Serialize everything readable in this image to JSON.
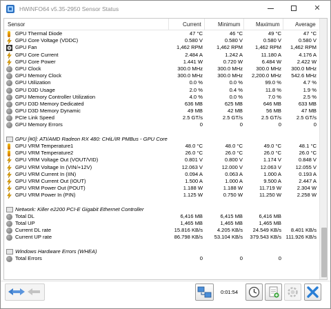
{
  "window": {
    "title": "HWiNFO64 v5.35-2950 Sensor Status"
  },
  "columns": {
    "sensor": "Sensor",
    "current": "Current",
    "minimum": "Minimum",
    "maximum": "Maximum",
    "average": "Average"
  },
  "rows": [
    {
      "kind": "sensor",
      "icon": "thermometer-icon",
      "name": "GPU Thermal Diode",
      "current": "47 °C",
      "minimum": "46 °C",
      "maximum": "49 °C",
      "average": "47 °C"
    },
    {
      "kind": "sensor",
      "icon": "voltage-icon",
      "name": "GPU Core Voltage (VDDC)",
      "current": "0.580 V",
      "minimum": "0.580 V",
      "maximum": "0.580 V",
      "average": "0.580 V"
    },
    {
      "kind": "sensor",
      "icon": "fan-icon",
      "name": "GPU Fan",
      "current": "1,462 RPM",
      "minimum": "1,462 RPM",
      "maximum": "1,462 RPM",
      "average": "1,462 RPM"
    },
    {
      "kind": "sensor",
      "icon": "current-icon",
      "name": "GPU Core Current",
      "current": "2.484 A",
      "minimum": "1.242 A",
      "maximum": "11.180 A",
      "average": "4.176 A"
    },
    {
      "kind": "sensor",
      "icon": "power-icon",
      "name": "GPU Core Power",
      "current": "1.441 W",
      "minimum": "0.720 W",
      "maximum": "6.484 W",
      "average": "2.422 W"
    },
    {
      "kind": "sensor",
      "icon": "clock-icon",
      "name": "GPU Clock",
      "current": "300.0 MHz",
      "minimum": "300.0 MHz",
      "maximum": "300.0 MHz",
      "average": "300.0 MHz"
    },
    {
      "kind": "sensor",
      "icon": "clock-icon",
      "name": "GPU Memory Clock",
      "current": "300.0 MHz",
      "minimum": "300.0 MHz",
      "maximum": "2,200.0 MHz",
      "average": "542.6 MHz"
    },
    {
      "kind": "sensor",
      "icon": "usage-icon",
      "name": "GPU Utilization",
      "current": "0.0 %",
      "minimum": "0.0 %",
      "maximum": "99.0 %",
      "average": "4.7 %"
    },
    {
      "kind": "sensor",
      "icon": "usage-icon",
      "name": "GPU D3D Usage",
      "current": "2.0 %",
      "minimum": "0.4 %",
      "maximum": "11.8 %",
      "average": "1.9 %"
    },
    {
      "kind": "sensor",
      "icon": "usage-icon",
      "name": "GPU Memory Controller Utilization",
      "current": "4.0 %",
      "minimum": "0.0 %",
      "maximum": "7.0 %",
      "average": "2.5 %"
    },
    {
      "kind": "sensor",
      "icon": "memory-icon",
      "name": "GPU D3D Memory Dedicated",
      "current": "636 MB",
      "minimum": "625 MB",
      "maximum": "646 MB",
      "average": "633 MB"
    },
    {
      "kind": "sensor",
      "icon": "memory-icon",
      "name": "GPU D3D Memory Dynamic",
      "current": "49 MB",
      "minimum": "42 MB",
      "maximum": "56 MB",
      "average": "47 MB"
    },
    {
      "kind": "sensor",
      "icon": "link-icon",
      "name": "PCIe Link Speed",
      "current": "2.5 GT/s",
      "minimum": "2.5 GT/s",
      "maximum": "2.5 GT/s",
      "average": "2.5 GT/s"
    },
    {
      "kind": "sensor",
      "icon": "error-icon",
      "name": "GPU Memory Errors",
      "current": "0",
      "minimum": "0",
      "maximum": "0",
      "average": "0"
    },
    {
      "kind": "gap"
    },
    {
      "kind": "group",
      "icon": "gpu-group-icon",
      "name": "GPU [#0]: ATI/AMD Radeon RX 480: CHiL/IR PMBus - GPU Core"
    },
    {
      "kind": "sensor",
      "icon": "thermometer-icon",
      "name": "GPU VRM Temperature1",
      "current": "48.0 °C",
      "minimum": "48.0 °C",
      "maximum": "49.0 °C",
      "average": "48.1 °C"
    },
    {
      "kind": "sensor",
      "icon": "thermometer-icon",
      "name": "GPU VRM Temperature2",
      "current": "26.0 °C",
      "minimum": "26.0 °C",
      "maximum": "26.0 °C",
      "average": "26.0 °C"
    },
    {
      "kind": "sensor",
      "icon": "voltage-icon",
      "name": "GPU VRM Voltage Out (VOUT/VID)",
      "current": "0.801 V",
      "minimum": "0.800 V",
      "maximum": "1.174 V",
      "average": "0.848 V"
    },
    {
      "kind": "sensor",
      "icon": "voltage-icon",
      "name": "GPU VRM Voltage In (VIN/+12V)",
      "current": "12.063 V",
      "minimum": "12.000 V",
      "maximum": "12.063 V",
      "average": "12.055 V"
    },
    {
      "kind": "sensor",
      "icon": "current-icon",
      "name": "GPU VRM Current In (IIN)",
      "current": "0.094 A",
      "minimum": "0.063 A",
      "maximum": "1.000 A",
      "average": "0.193 A"
    },
    {
      "kind": "sensor",
      "icon": "current-icon",
      "name": "GPU VRM Current Out (IOUT)",
      "current": "1.500 A",
      "minimum": "1.000 A",
      "maximum": "9.500 A",
      "average": "2.447 A"
    },
    {
      "kind": "sensor",
      "icon": "power-icon",
      "name": "GPU VRM Power Out (POUT)",
      "current": "1.188 W",
      "minimum": "1.188 W",
      "maximum": "11.719 W",
      "average": "2.304 W"
    },
    {
      "kind": "sensor",
      "icon": "power-icon",
      "name": "GPU VRM Power In (PIN)",
      "current": "1.125 W",
      "minimum": "0.750 W",
      "maximum": "11.250 W",
      "average": "2.258 W"
    },
    {
      "kind": "gap"
    },
    {
      "kind": "group",
      "icon": "network-group-icon",
      "name": "Network: Killer e2200 PCI-E Gigabit Ethernet Controller"
    },
    {
      "kind": "sensor",
      "icon": "data-icon",
      "name": "Total DL",
      "current": "6,416 MB",
      "minimum": "6,415 MB",
      "maximum": "6,416 MB",
      "average": ""
    },
    {
      "kind": "sensor",
      "icon": "data-icon",
      "name": "Total UP",
      "current": "1,465 MB",
      "minimum": "1,465 MB",
      "maximum": "1,465 MB",
      "average": ""
    },
    {
      "kind": "sensor",
      "icon": "rate-icon",
      "name": "Current DL rate",
      "current": "15.816 KB/s",
      "minimum": "4.205 KB/s",
      "maximum": "24.549 KB/s",
      "average": "8.401 KB/s"
    },
    {
      "kind": "sensor",
      "icon": "rate-icon",
      "name": "Current UP rate",
      "current": "86.798 KB/s",
      "minimum": "53.104 KB/s",
      "maximum": "379.543 KB/s",
      "average": "111.926 KB/s"
    },
    {
      "kind": "gap"
    },
    {
      "kind": "group",
      "icon": "windows-group-icon",
      "name": "Windows Hardware Errors (WHEA)"
    },
    {
      "kind": "sensor",
      "icon": "error-icon",
      "name": "Total Errors",
      "current": "0",
      "minimum": "0",
      "maximum": "0",
      "average": ""
    }
  ],
  "toolbar": {
    "elapsed": "0:01:54",
    "nav_icon": "navigate-arrows-icon",
    "network_icon": "network-computers-icon",
    "clock_icon": "clock-reset-icon",
    "log_icon": "add-log-icon",
    "settings_icon": "settings-gear-icon",
    "close_icon": "close-x-icon"
  },
  "colors": {
    "accent_blue": "#1e6fd0",
    "close_x": "#2a7fd6"
  }
}
